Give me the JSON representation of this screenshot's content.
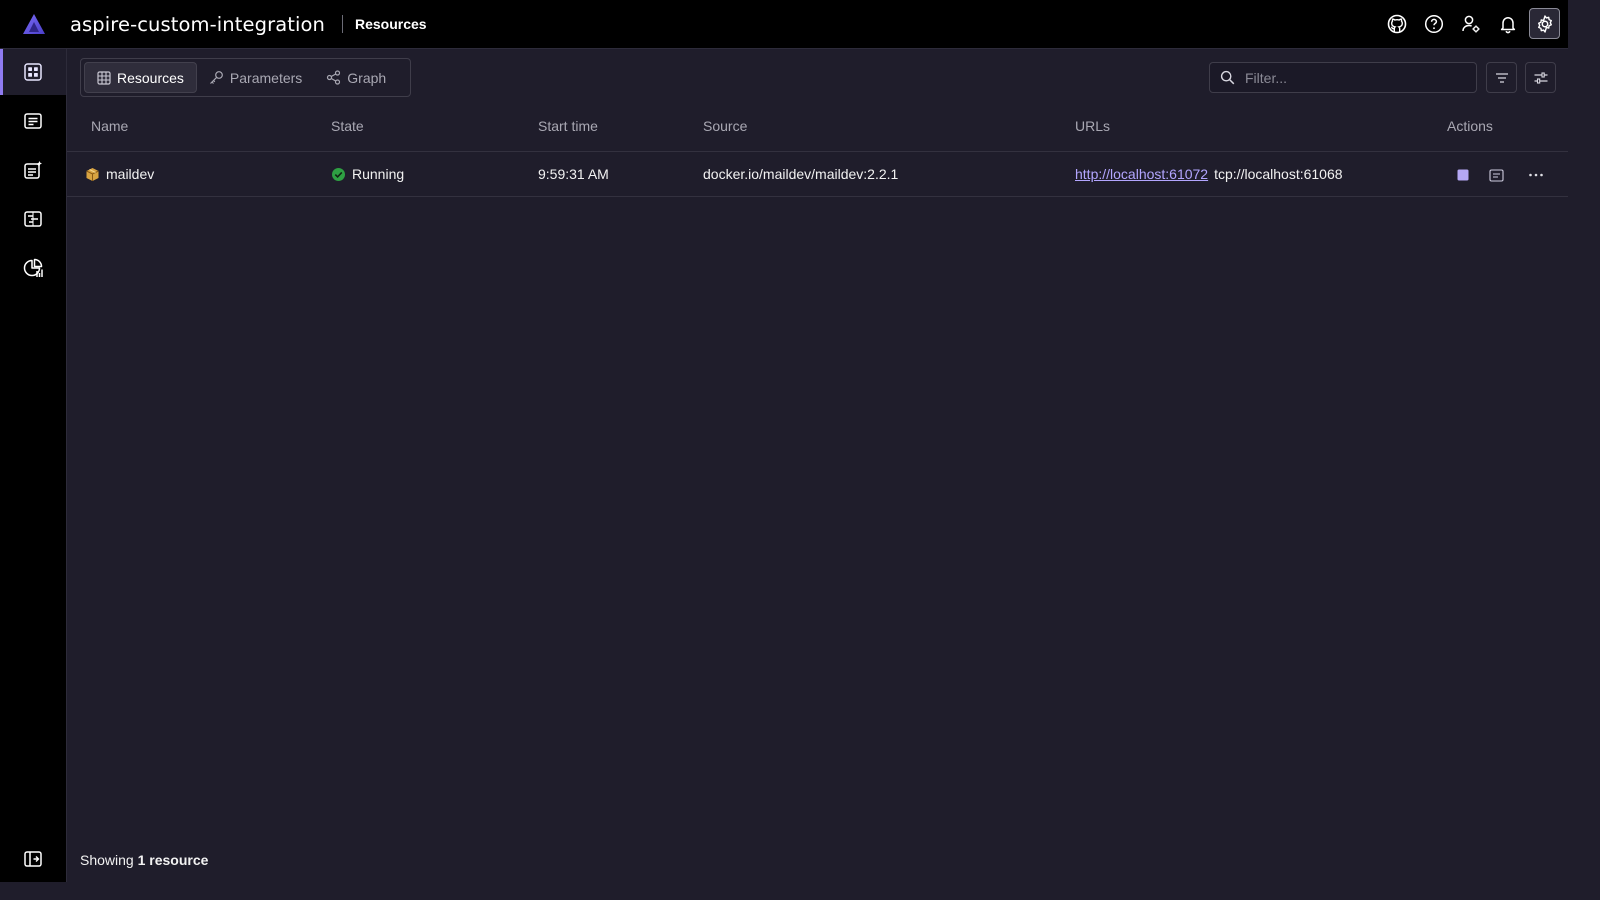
{
  "app": {
    "title": "aspire-custom-integration",
    "page": "Resources"
  },
  "header_icons": [
    "github-icon",
    "help-icon",
    "user-settings-icon",
    "notifications-icon",
    "settings-icon"
  ],
  "sidebar": {
    "items": [
      {
        "name": "resources",
        "icon": "resources-icon",
        "active": true
      },
      {
        "name": "console",
        "icon": "console-logs-icon"
      },
      {
        "name": "structured",
        "icon": "structured-logs-icon"
      },
      {
        "name": "traces",
        "icon": "traces-icon"
      },
      {
        "name": "metrics",
        "icon": "metrics-icon"
      }
    ],
    "collapse_icon": "collapse-panel-icon"
  },
  "tabs": [
    {
      "label": "Resources",
      "icon": "grid-icon",
      "active": true
    },
    {
      "label": "Parameters",
      "icon": "key-icon"
    },
    {
      "label": "Graph",
      "icon": "share-icon"
    }
  ],
  "filter": {
    "placeholder": "Filter..."
  },
  "table": {
    "columns": [
      "Name",
      "State",
      "Start time",
      "Source",
      "URLs",
      "Actions"
    ],
    "rows": [
      {
        "name": "maildev",
        "state": "Running",
        "start_time": "9:59:31 AM",
        "source": "docker.io/maildev/maildev:2.2.1",
        "url_http": "http://localhost:61072",
        "url_tcp": "tcp://localhost:61068"
      }
    ]
  },
  "footer": {
    "prefix": "Showing",
    "count": "1 resource"
  },
  "colors": {
    "accent": "#8f7bf0",
    "running": "#2ea043",
    "link": "#b3a6ff",
    "background": "#1f1d2b"
  }
}
